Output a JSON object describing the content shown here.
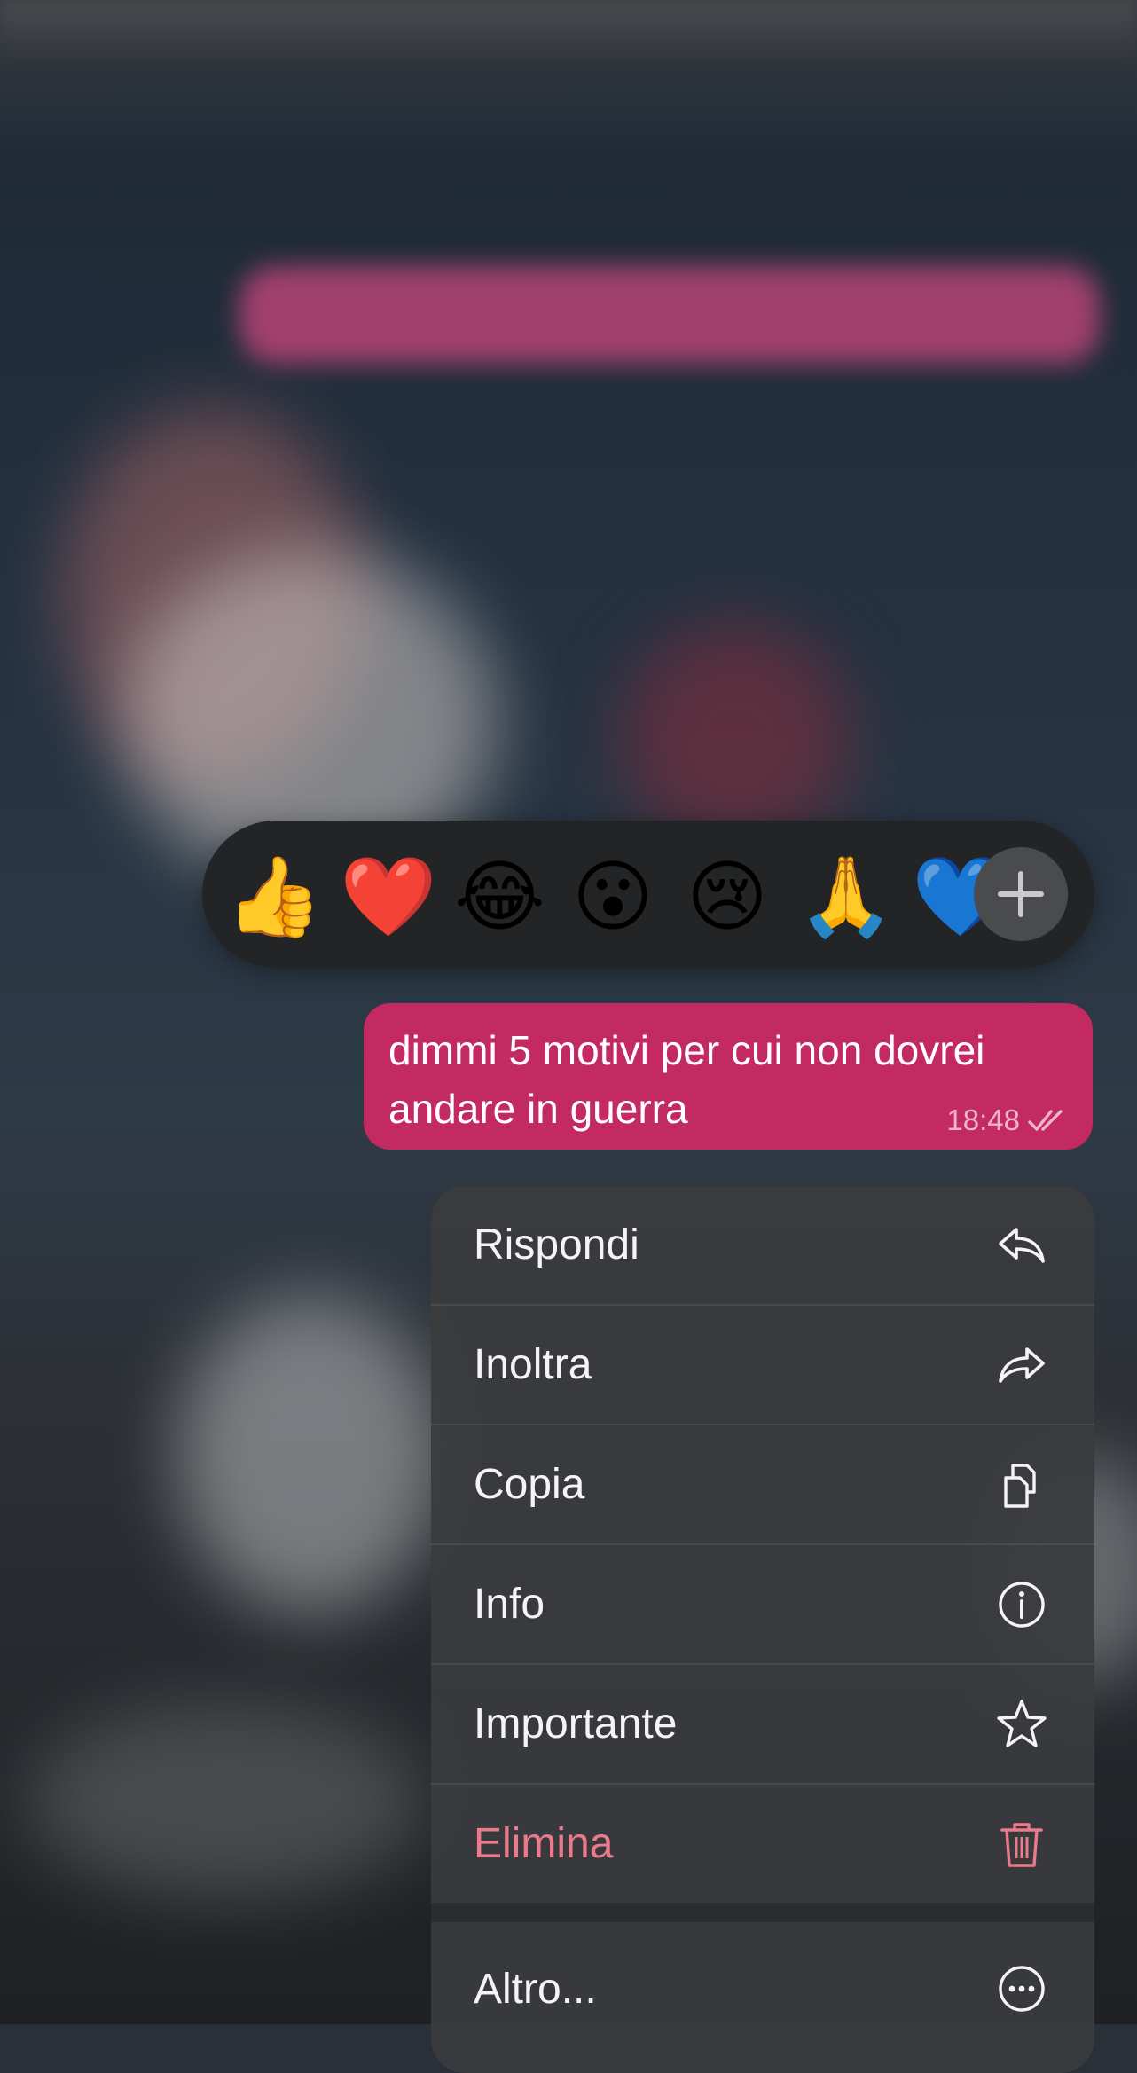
{
  "reactions": {
    "emojis": [
      "👍",
      "❤️",
      "😂",
      "😮",
      "😢",
      "🙏",
      "💙"
    ],
    "more_label": "+"
  },
  "message": {
    "text": "dimmi 5 motivi per cui non dovrei andare in guerra",
    "line1": "dimmi 5 motivi per cui non dovrei",
    "line2": "andare in guerra",
    "time": "18:48",
    "status_icon": "double-check-icon",
    "bubble_color": "#c22a61"
  },
  "menu": {
    "items": [
      {
        "label": "Rispondi",
        "icon": "reply-icon"
      },
      {
        "label": "Inoltra",
        "icon": "forward-icon"
      },
      {
        "label": "Copia",
        "icon": "copy-icon"
      },
      {
        "label": "Info",
        "icon": "info-icon"
      },
      {
        "label": "Importante",
        "icon": "star-icon"
      },
      {
        "label": "Elimina",
        "icon": "trash-icon",
        "color": "#ec7a8d"
      }
    ],
    "more": {
      "label": "Altro...",
      "icon": "more-icon"
    }
  }
}
